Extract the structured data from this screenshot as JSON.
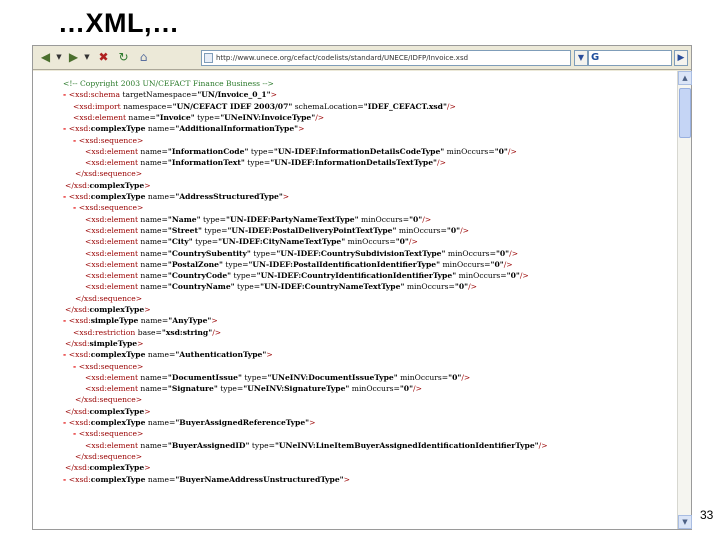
{
  "slide": {
    "title": "…XML,…",
    "page_number": "33"
  },
  "browser": {
    "nav": {
      "back_icon": "back-arrow-icon",
      "forward_icon": "forward-arrow-icon",
      "stop_icon": "stop-icon",
      "refresh_icon": "refresh-icon",
      "home_icon": "home-icon"
    },
    "address": "http://www.unece.org/cefact/codelists/standard/UNECE/IDFP/Invoice.xsd",
    "search_badge": "G"
  },
  "xml_lines": [
    {
      "indent": 30,
      "sign": "",
      "parts": [
        {
          "c": "comment",
          "t": "<!-- Copyright 2003 UN/CEFACT Finance Business -->"
        }
      ]
    },
    {
      "indent": 30,
      "sign": "-",
      "parts": [
        {
          "c": "tag",
          "t": "<xsd:schema"
        },
        {
          "c": "attr",
          "t": " targetNamespace="
        },
        {
          "c": "val",
          "t": "\"UN/Invoice_0_1\""
        },
        {
          "c": "tag",
          "t": ">"
        }
      ]
    },
    {
      "indent": 40,
      "sign": "",
      "parts": [
        {
          "c": "tag",
          "t": "<xsd:import"
        },
        {
          "c": "attr",
          "t": " namespace="
        },
        {
          "c": "val",
          "t": "\"UN/CEFACT IDEF 2003/07\""
        },
        {
          "c": "attr",
          "t": " schemaLocation="
        },
        {
          "c": "val",
          "t": "\"IDEF_CEFACT.xsd\""
        },
        {
          "c": "tag",
          "t": "/>"
        }
      ]
    },
    {
      "indent": 40,
      "sign": "",
      "parts": [
        {
          "c": "tag",
          "t": "<xsd:element"
        },
        {
          "c": "attr",
          "t": " name="
        },
        {
          "c": "val",
          "t": "\"Invoice\""
        },
        {
          "c": "attr",
          "t": " type="
        },
        {
          "c": "val",
          "t": "\"UNeINV:InvoiceType\""
        },
        {
          "c": "tag",
          "t": "/>"
        }
      ]
    },
    {
      "indent": 30,
      "sign": "-",
      "parts": [
        {
          "c": "tag",
          "t": "<xsd:"
        },
        {
          "c": "kw",
          "t": "complexType"
        },
        {
          "c": "attr",
          "t": " name="
        },
        {
          "c": "val",
          "t": "\"AdditionalInformationType\""
        },
        {
          "c": "tag",
          "t": ">"
        }
      ]
    },
    {
      "indent": 40,
      "sign": "-",
      "parts": [
        {
          "c": "tag",
          "t": "<xsd:sequence>"
        }
      ]
    },
    {
      "indent": 52,
      "sign": "",
      "parts": [
        {
          "c": "tag",
          "t": "<xsd:element"
        },
        {
          "c": "attr",
          "t": " name="
        },
        {
          "c": "val",
          "t": "\"InformationCode\""
        },
        {
          "c": "attr",
          "t": " type="
        },
        {
          "c": "val",
          "t": "\"UN-IDEF:InformationDetailsCodeType\""
        },
        {
          "c": "attr",
          "t": " minOccurs="
        },
        {
          "c": "val",
          "t": "\"0\""
        },
        {
          "c": "tag",
          "t": "/>"
        }
      ]
    },
    {
      "indent": 52,
      "sign": "",
      "parts": [
        {
          "c": "tag",
          "t": "<xsd:element"
        },
        {
          "c": "attr",
          "t": " name="
        },
        {
          "c": "val",
          "t": "\"InformationText\""
        },
        {
          "c": "attr",
          "t": " type="
        },
        {
          "c": "val",
          "t": "\"UN-IDEF:InformationDetailsTextType\""
        },
        {
          "c": "tag",
          "t": "/>"
        }
      ]
    },
    {
      "indent": 42,
      "sign": "",
      "parts": [
        {
          "c": "tag",
          "t": "</xsd:sequence>"
        }
      ]
    },
    {
      "indent": 32,
      "sign": "",
      "parts": [
        {
          "c": "tag",
          "t": "</xsd:"
        },
        {
          "c": "kw",
          "t": "complexType"
        },
        {
          "c": "tag",
          "t": ">"
        }
      ]
    },
    {
      "indent": 30,
      "sign": "-",
      "parts": [
        {
          "c": "tag",
          "t": "<xsd:"
        },
        {
          "c": "kw",
          "t": "complexType"
        },
        {
          "c": "attr",
          "t": " name="
        },
        {
          "c": "val",
          "t": "\"AddressStructuredType\""
        },
        {
          "c": "tag",
          "t": ">"
        }
      ]
    },
    {
      "indent": 40,
      "sign": "-",
      "parts": [
        {
          "c": "tag",
          "t": "<xsd:sequence>"
        }
      ]
    },
    {
      "indent": 52,
      "sign": "",
      "parts": [
        {
          "c": "tag",
          "t": "<xsd:element"
        },
        {
          "c": "attr",
          "t": " name="
        },
        {
          "c": "val",
          "t": "\"Name\""
        },
        {
          "c": "attr",
          "t": " type="
        },
        {
          "c": "val",
          "t": "\"UN-IDEF:PartyNameTextType\""
        },
        {
          "c": "attr",
          "t": " minOccurs="
        },
        {
          "c": "val",
          "t": "\"0\""
        },
        {
          "c": "tag",
          "t": "/>"
        }
      ]
    },
    {
      "indent": 52,
      "sign": "",
      "parts": [
        {
          "c": "tag",
          "t": "<xsd:element"
        },
        {
          "c": "attr",
          "t": " name="
        },
        {
          "c": "val",
          "t": "\"Street\""
        },
        {
          "c": "attr",
          "t": " type="
        },
        {
          "c": "val",
          "t": "\"UN-IDEF:PostalDeliveryPointTextType\""
        },
        {
          "c": "attr",
          "t": " minOccurs="
        },
        {
          "c": "val",
          "t": "\"0\""
        },
        {
          "c": "tag",
          "t": "/>"
        }
      ]
    },
    {
      "indent": 52,
      "sign": "",
      "parts": [
        {
          "c": "tag",
          "t": "<xsd:element"
        },
        {
          "c": "attr",
          "t": " name="
        },
        {
          "c": "val",
          "t": "\"City\""
        },
        {
          "c": "attr",
          "t": " type="
        },
        {
          "c": "val",
          "t": "\"UN-IDEF:CityNameTextType\""
        },
        {
          "c": "attr",
          "t": " minOccurs="
        },
        {
          "c": "val",
          "t": "\"0\""
        },
        {
          "c": "tag",
          "t": "/>"
        }
      ]
    },
    {
      "indent": 52,
      "sign": "",
      "parts": [
        {
          "c": "tag",
          "t": "<xsd:element"
        },
        {
          "c": "attr",
          "t": " name="
        },
        {
          "c": "val",
          "t": "\"CountrySubentity\""
        },
        {
          "c": "attr",
          "t": " type="
        },
        {
          "c": "val",
          "t": "\"UN-IDEF:CountrySubdivisionTextType\""
        },
        {
          "c": "attr",
          "t": " minOccurs="
        },
        {
          "c": "val",
          "t": "\"0\""
        },
        {
          "c": "tag",
          "t": "/>"
        }
      ]
    },
    {
      "indent": 52,
      "sign": "",
      "parts": [
        {
          "c": "tag",
          "t": "<xsd:element"
        },
        {
          "c": "attr",
          "t": " name="
        },
        {
          "c": "val",
          "t": "\"PostalZone\""
        },
        {
          "c": "attr",
          "t": " type="
        },
        {
          "c": "val",
          "t": "\"UN-IDEF:PostalIdentificationIdentifierType\""
        },
        {
          "c": "attr",
          "t": " minOccurs="
        },
        {
          "c": "val",
          "t": "\"0\""
        },
        {
          "c": "tag",
          "t": "/>"
        }
      ]
    },
    {
      "indent": 52,
      "sign": "",
      "parts": [
        {
          "c": "tag",
          "t": "<xsd:element"
        },
        {
          "c": "attr",
          "t": " name="
        },
        {
          "c": "val",
          "t": "\"CountryCode\""
        },
        {
          "c": "attr",
          "t": " type="
        },
        {
          "c": "val",
          "t": "\"UN-IDEF:CountryIdentificationIdentifierType\""
        },
        {
          "c": "attr",
          "t": " minOccurs="
        },
        {
          "c": "val",
          "t": "\"0\""
        },
        {
          "c": "tag",
          "t": "/>"
        }
      ]
    },
    {
      "indent": 52,
      "sign": "",
      "parts": [
        {
          "c": "tag",
          "t": "<xsd:element"
        },
        {
          "c": "attr",
          "t": " name="
        },
        {
          "c": "val",
          "t": "\"CountryName\""
        },
        {
          "c": "attr",
          "t": " type="
        },
        {
          "c": "val",
          "t": "\"UN-IDEF:CountryNameTextType\""
        },
        {
          "c": "attr",
          "t": " minOccurs="
        },
        {
          "c": "val",
          "t": "\"0\""
        },
        {
          "c": "tag",
          "t": "/>"
        }
      ]
    },
    {
      "indent": 42,
      "sign": "",
      "parts": [
        {
          "c": "tag",
          "t": "</xsd:sequence>"
        }
      ]
    },
    {
      "indent": 32,
      "sign": "",
      "parts": [
        {
          "c": "tag",
          "t": "</xsd:"
        },
        {
          "c": "kw",
          "t": "complexType"
        },
        {
          "c": "tag",
          "t": ">"
        }
      ]
    },
    {
      "indent": 30,
      "sign": "-",
      "parts": [
        {
          "c": "tag",
          "t": "<xsd:"
        },
        {
          "c": "kw",
          "t": "simpleType"
        },
        {
          "c": "attr",
          "t": " name="
        },
        {
          "c": "val",
          "t": "\"AnyType\""
        },
        {
          "c": "tag",
          "t": ">"
        }
      ]
    },
    {
      "indent": 40,
      "sign": "",
      "parts": [
        {
          "c": "tag",
          "t": "<xsd:restriction"
        },
        {
          "c": "attr",
          "t": " base="
        },
        {
          "c": "val",
          "t": "\"xsd:string\""
        },
        {
          "c": "tag",
          "t": "/>"
        }
      ]
    },
    {
      "indent": 32,
      "sign": "",
      "parts": [
        {
          "c": "tag",
          "t": "</xsd:"
        },
        {
          "c": "kw",
          "t": "simpleType"
        },
        {
          "c": "tag",
          "t": ">"
        }
      ]
    },
    {
      "indent": 30,
      "sign": "-",
      "parts": [
        {
          "c": "tag",
          "t": "<xsd:"
        },
        {
          "c": "kw",
          "t": "complexType"
        },
        {
          "c": "attr",
          "t": " name="
        },
        {
          "c": "val",
          "t": "\"AuthenticationType\""
        },
        {
          "c": "tag",
          "t": ">"
        }
      ]
    },
    {
      "indent": 40,
      "sign": "-",
      "parts": [
        {
          "c": "tag",
          "t": "<xsd:sequence>"
        }
      ]
    },
    {
      "indent": 52,
      "sign": "",
      "parts": [
        {
          "c": "tag",
          "t": "<xsd:element"
        },
        {
          "c": "attr",
          "t": " name="
        },
        {
          "c": "val",
          "t": "\"DocumentIssue\""
        },
        {
          "c": "attr",
          "t": " type="
        },
        {
          "c": "val",
          "t": "\"UNeINV:DocumentIssueType\""
        },
        {
          "c": "attr",
          "t": " minOccurs="
        },
        {
          "c": "val",
          "t": "\"0\""
        },
        {
          "c": "tag",
          "t": "/>"
        }
      ]
    },
    {
      "indent": 52,
      "sign": "",
      "parts": [
        {
          "c": "tag",
          "t": "<xsd:element"
        },
        {
          "c": "attr",
          "t": " name="
        },
        {
          "c": "val",
          "t": "\"Signature\""
        },
        {
          "c": "attr",
          "t": " type="
        },
        {
          "c": "val",
          "t": "\"UNeINV:SignatureType\""
        },
        {
          "c": "attr",
          "t": " minOccurs="
        },
        {
          "c": "val",
          "t": "\"0\""
        },
        {
          "c": "tag",
          "t": "/>"
        }
      ]
    },
    {
      "indent": 42,
      "sign": "",
      "parts": [
        {
          "c": "tag",
          "t": "</xsd:sequence>"
        }
      ]
    },
    {
      "indent": 32,
      "sign": "",
      "parts": [
        {
          "c": "tag",
          "t": "</xsd:"
        },
        {
          "c": "kw",
          "t": "complexType"
        },
        {
          "c": "tag",
          "t": ">"
        }
      ]
    },
    {
      "indent": 30,
      "sign": "-",
      "parts": [
        {
          "c": "tag",
          "t": "<xsd:"
        },
        {
          "c": "kw",
          "t": "complexType"
        },
        {
          "c": "attr",
          "t": " name="
        },
        {
          "c": "val",
          "t": "\"BuyerAssignedReferenceType\""
        },
        {
          "c": "tag",
          "t": ">"
        }
      ]
    },
    {
      "indent": 40,
      "sign": "-",
      "parts": [
        {
          "c": "tag",
          "t": "<xsd:sequence>"
        }
      ]
    },
    {
      "indent": 52,
      "sign": "",
      "parts": [
        {
          "c": "tag",
          "t": "<xsd:element"
        },
        {
          "c": "attr",
          "t": " name="
        },
        {
          "c": "val",
          "t": "\"BuyerAssignedID\""
        },
        {
          "c": "attr",
          "t": " type="
        },
        {
          "c": "val",
          "t": "\"UNeINV:LineItemBuyerAssignedIdentificationIdentifierType\""
        },
        {
          "c": "tag",
          "t": "/>"
        }
      ]
    },
    {
      "indent": 42,
      "sign": "",
      "parts": [
        {
          "c": "tag",
          "t": "</xsd:sequence>"
        }
      ]
    },
    {
      "indent": 32,
      "sign": "",
      "parts": [
        {
          "c": "tag",
          "t": "</xsd:"
        },
        {
          "c": "kw",
          "t": "complexType"
        },
        {
          "c": "tag",
          "t": ">"
        }
      ]
    },
    {
      "indent": 30,
      "sign": "-",
      "parts": [
        {
          "c": "tag",
          "t": "<xsd:"
        },
        {
          "c": "kw",
          "t": "complexType"
        },
        {
          "c": "attr",
          "t": " name="
        },
        {
          "c": "val",
          "t": "\"BuyerNameAddressUnstructuredType\""
        },
        {
          "c": "tag",
          "t": ">"
        }
      ]
    }
  ],
  "colors": {
    "tag": "#990000",
    "sign": "#e00000",
    "comment": "#2a7a2a",
    "chrome": "#ece9d8"
  }
}
